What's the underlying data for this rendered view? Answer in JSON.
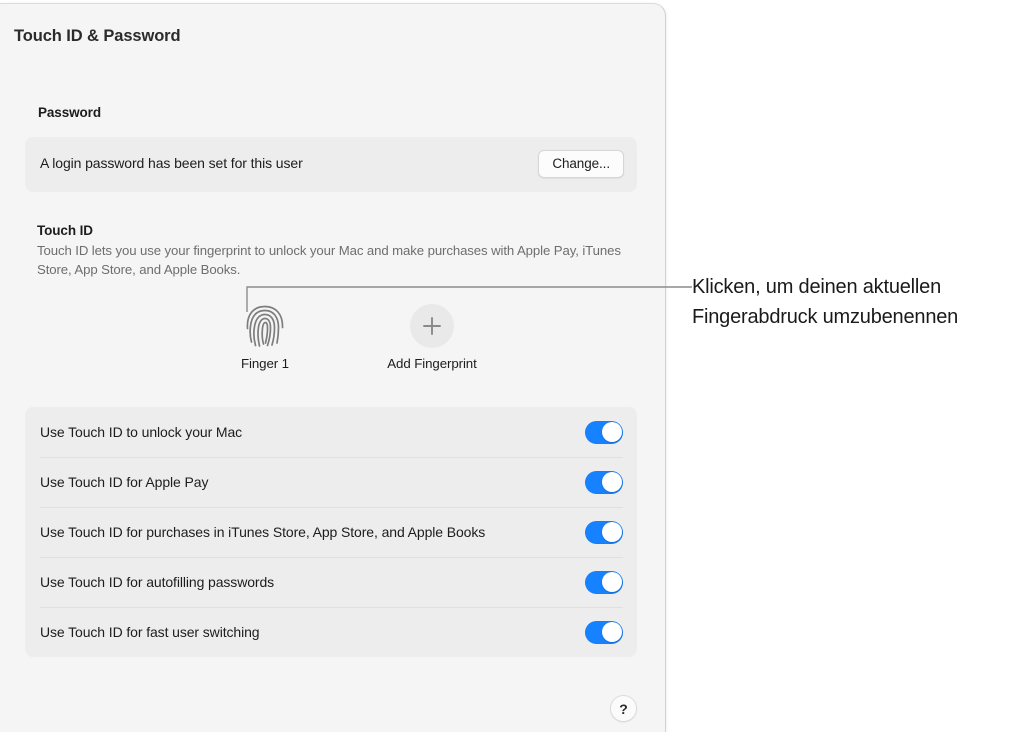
{
  "window": {
    "title": "Touch ID & Password"
  },
  "password_section": {
    "header": "Password",
    "status_text": "A login password has been set for this user",
    "change_button_label": "Change..."
  },
  "touch_id_section": {
    "header": "Touch ID",
    "description": "Touch ID lets you use your fingerprint to unlock your Mac and make purchases with Apple Pay, iTunes Store, App Store, and Apple Books.",
    "fingerprints": [
      {
        "label": "Finger 1",
        "icon": "fingerprint-icon"
      },
      {
        "label": "Add Fingerprint",
        "icon": "plus-icon"
      }
    ]
  },
  "options": [
    {
      "label": "Use Touch ID to unlock your Mac",
      "enabled": true
    },
    {
      "label": "Use Touch ID for Apple Pay",
      "enabled": true
    },
    {
      "label": "Use Touch ID for purchases in iTunes Store, App Store, and Apple Books",
      "enabled": true
    },
    {
      "label": "Use Touch ID for autofilling passwords",
      "enabled": true
    },
    {
      "label": "Use Touch ID for fast user switching",
      "enabled": true
    }
  ],
  "help": {
    "label": "?"
  },
  "callout": {
    "text": "Klicken, um deinen aktuellen Fingerabdruck umzubenennen"
  },
  "colors": {
    "toggle_on": "#1782ff",
    "window_background": "#f5f5f5",
    "card_background": "#ededed",
    "page_background": "#ffffff"
  }
}
